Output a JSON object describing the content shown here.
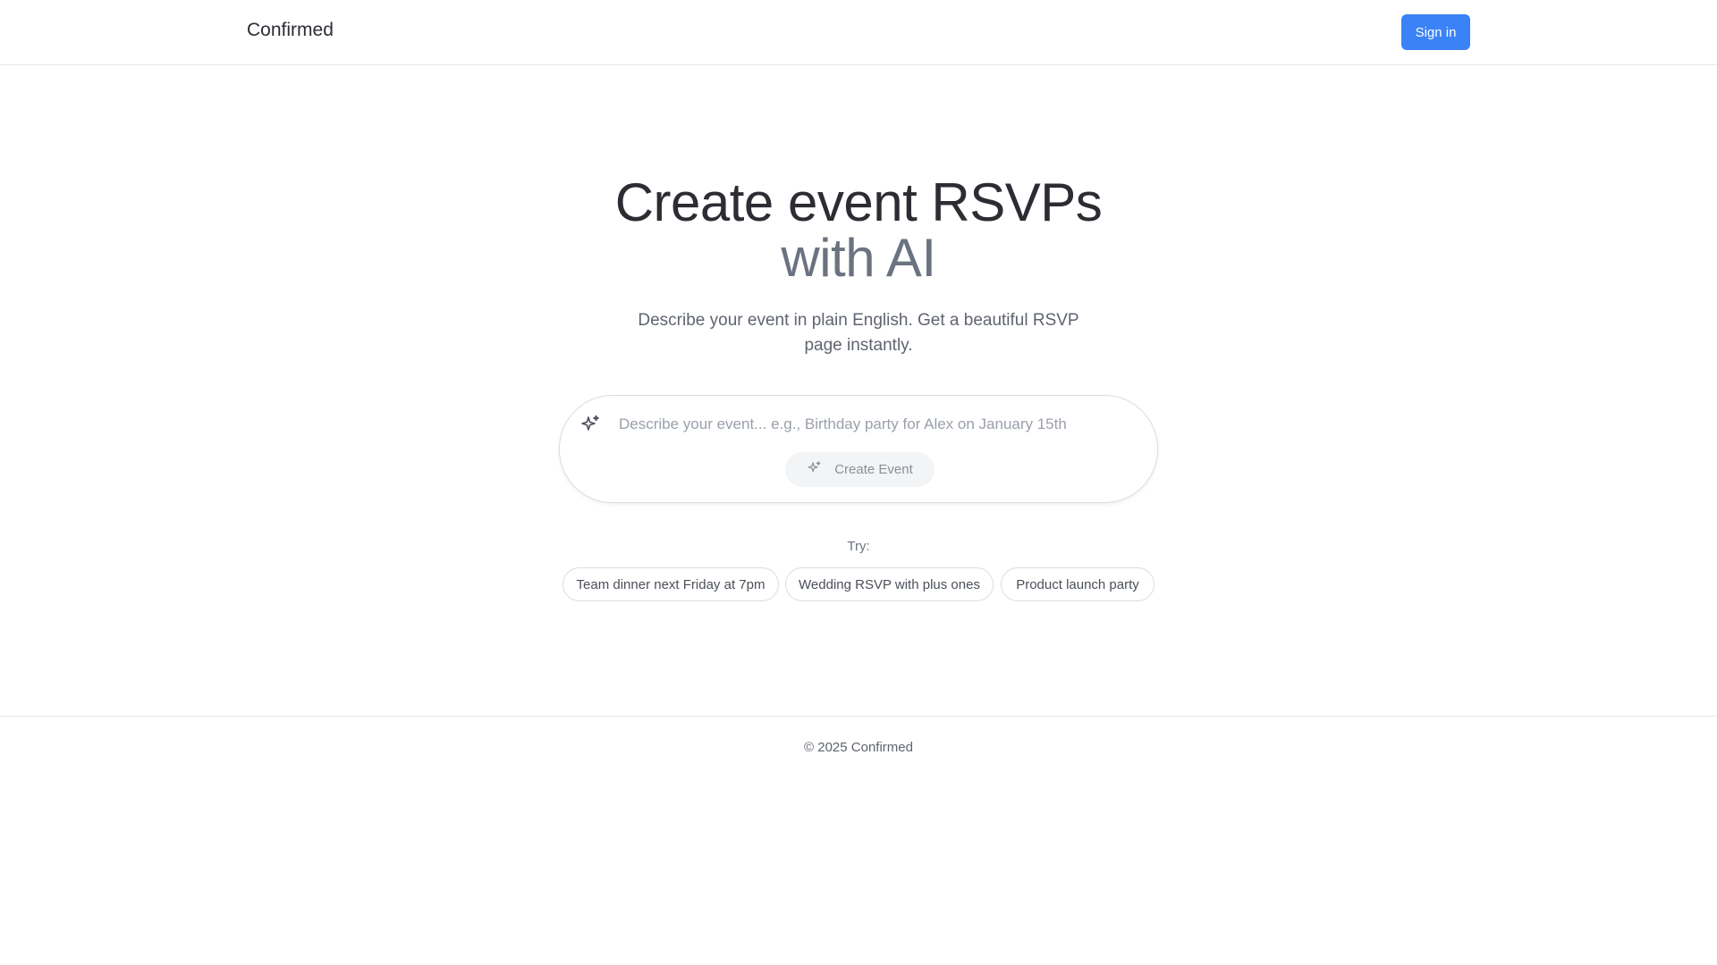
{
  "header": {
    "brand": "Confirmed",
    "signin_label": "Sign in",
    "signin_color": "#3b82f6"
  },
  "hero": {
    "title_line1": "Create event RSVPs",
    "title_line2": "with AI",
    "subtitle": "Describe your event in plain English. Get a beautiful RSVP page instantly."
  },
  "prompt": {
    "icon": "sparkles-icon",
    "value": "",
    "placeholder": "Describe your event... e.g., Birthday party for Alex on January 15th",
    "button_label": "Create Event",
    "button_icon": "sparkles-icon"
  },
  "suggestions": {
    "label": "Try:",
    "items": [
      "Team dinner next Friday at 7pm",
      "Wedding RSVP with plus ones",
      "Product launch party"
    ]
  },
  "footer": {
    "copyright": "© 2025 Confirmed"
  }
}
